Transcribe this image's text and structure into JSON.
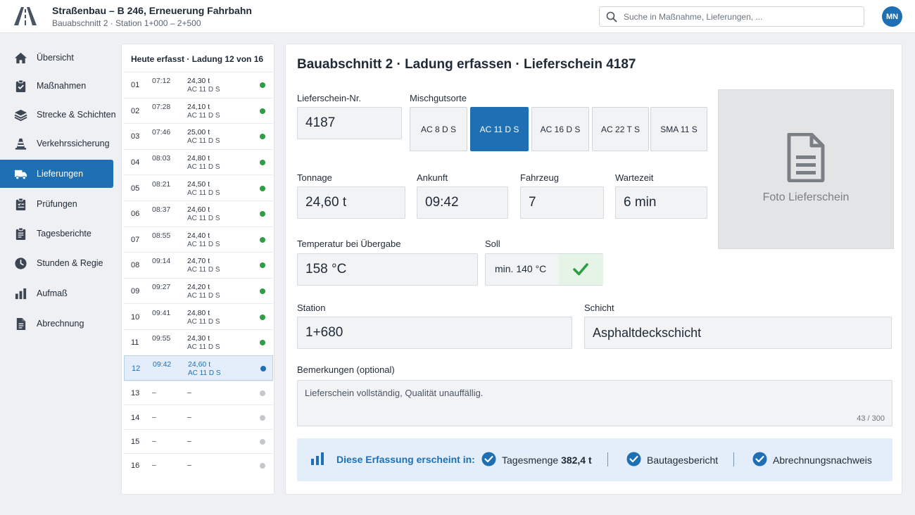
{
  "header": {
    "title": "Straßenbau – B 246, Erneuerung Fahrbahn",
    "subtitle": "Bauabschnitt 2 · Station 1+000 – 2+500",
    "search_placeholder": "Suche in Maßnahme, Lieferungen, ...",
    "avatar_initials": "MN",
    "accent_color": "#1f6fb5"
  },
  "sidebar": {
    "items": [
      {
        "label": "Übersicht",
        "icon": "home-icon"
      },
      {
        "label": "Maßnahmen",
        "icon": "clipboard-check-icon"
      },
      {
        "label": "Strecke & Schichten",
        "icon": "layers-icon"
      },
      {
        "label": "Verkehrssicherung",
        "icon": "traffic-cone-icon"
      },
      {
        "label": "Lieferungen",
        "icon": "truck-icon",
        "active": true
      },
      {
        "label": "Prüfungen",
        "icon": "checklist-icon"
      },
      {
        "label": "Tagesberichte",
        "icon": "report-icon"
      },
      {
        "label": "Stunden & Regie",
        "icon": "clock-icon"
      },
      {
        "label": "Aufmaß",
        "icon": "bar-chart-icon"
      },
      {
        "label": "Abrechnung",
        "icon": "document-icon"
      }
    ]
  },
  "deliveries": {
    "heading": "Heute erfasst · Ladung 12 von 16",
    "rows": [
      {
        "no": "01",
        "time": "07:12",
        "tons": "24,30 t",
        "mix": "AC 11 D S",
        "status": "done"
      },
      {
        "no": "02",
        "time": "07:28",
        "tons": "24,10 t",
        "mix": "AC 11 D S",
        "status": "done"
      },
      {
        "no": "03",
        "time": "07:46",
        "tons": "25,00 t",
        "mix": "AC 11 D S",
        "status": "done"
      },
      {
        "no": "04",
        "time": "08:03",
        "tons": "24,80 t",
        "mix": "AC 11 D S",
        "status": "done"
      },
      {
        "no": "05",
        "time": "08:21",
        "tons": "24,50 t",
        "mix": "AC 11 D S",
        "status": "done"
      },
      {
        "no": "06",
        "time": "08:37",
        "tons": "24,60 t",
        "mix": "AC 11 D S",
        "status": "done"
      },
      {
        "no": "07",
        "time": "08:55",
        "tons": "24,40 t",
        "mix": "AC 11 D S",
        "status": "done"
      },
      {
        "no": "08",
        "time": "09:14",
        "tons": "24,70 t",
        "mix": "AC 11 D S",
        "status": "done"
      },
      {
        "no": "09",
        "time": "09:27",
        "tons": "24,20 t",
        "mix": "AC 11 D S",
        "status": "done"
      },
      {
        "no": "10",
        "time": "09:41",
        "tons": "24,80 t",
        "mix": "AC 11 D S",
        "status": "done"
      },
      {
        "no": "11",
        "time": "09:55",
        "tons": "24,30 t",
        "mix": "AC 11 D S",
        "status": "done"
      },
      {
        "no": "12",
        "time": "09:42",
        "tons": "24,60 t",
        "mix": "AC 11 D S",
        "status": "current"
      },
      {
        "no": "13",
        "time": "–",
        "tons": "–",
        "mix": "",
        "status": "pending"
      },
      {
        "no": "14",
        "time": "–",
        "tons": "–",
        "mix": "",
        "status": "pending"
      },
      {
        "no": "15",
        "time": "–",
        "tons": "–",
        "mix": "",
        "status": "pending"
      },
      {
        "no": "16",
        "time": "–",
        "tons": "–",
        "mix": "",
        "status": "pending"
      }
    ],
    "status_colors": {
      "done": "#2e9e44",
      "current": "#1f6fb5",
      "pending": "#c4c8cd"
    }
  },
  "form": {
    "title": "Bauabschnitt 2 · Ladung erfassen · Lieferschein 4187",
    "lieferschein_label": "Lieferschein-Nr.",
    "lieferschein_value": "4187",
    "mix_label": "Mischgutsorte",
    "mix_options": [
      "AC 8 D S",
      "AC 11 D S",
      "AC 16 D S",
      "AC 22 T S",
      "SMA 11 S"
    ],
    "mix_selected": "AC 11 D S",
    "photo_label": "Foto Lieferschein",
    "tonnage_label": "Tonnage",
    "tonnage_value": "24,60 t",
    "arrival_label": "Ankunft",
    "arrival_value": "09:42",
    "vehicle_label": "Fahrzeug",
    "vehicle_value": "7",
    "wait_label": "Wartezeit",
    "wait_value": "6 min",
    "temp_label": "Temperatur bei Übergabe",
    "temp_value": "158 °C",
    "soll_label": "Soll",
    "soll_value": "min. 140 °C",
    "station_label": "Station",
    "station_value": "1+680",
    "layer_label": "Schicht",
    "layer_value": "Asphaltdeckschicht",
    "remarks_label": "Bemerkungen (optional)",
    "remarks_value": "Lieferschein vollständig, Qualität unauffällig.",
    "remarks_count": "43 / 300"
  },
  "info_bar": {
    "lead": "Diese Erfassung erscheint in:",
    "item1_text": "Tagesmenge",
    "item1_value": "382,4 t",
    "item2_text": "Bautagesbericht",
    "item3_text": "Abrechnungsnachweis"
  }
}
